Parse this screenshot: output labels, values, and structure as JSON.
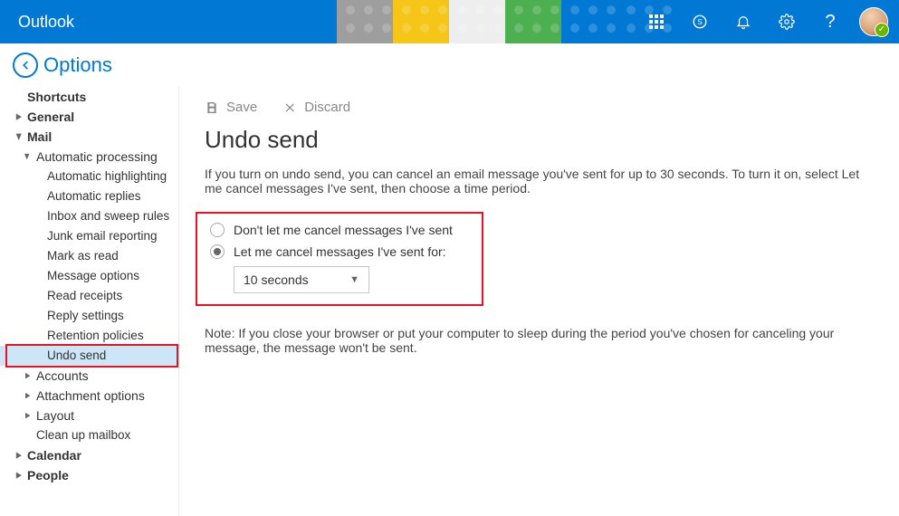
{
  "header": {
    "brand": "Outlook"
  },
  "options_label": "Options",
  "action": {
    "save": "Save",
    "discard": "Discard"
  },
  "page": {
    "title": "Undo send",
    "description": "If you turn on undo send, you can cancel an email message you've sent for up to 30 seconds. To turn it on, select Let me cancel messages I've sent, then choose a time period.",
    "radio_off": "Don't let me cancel messages I've sent",
    "radio_on": "Let me cancel messages I've sent for:",
    "select_value": "10 seconds",
    "note": "Note: If you close your browser or put your computer to sleep during the period you've chosen for canceling your message, the message won't be sent."
  },
  "sidebar": {
    "shortcuts": "Shortcuts",
    "general": "General",
    "mail": "Mail",
    "auto_processing": "Automatic processing",
    "auto_highlight": "Automatic highlighting",
    "auto_replies": "Automatic replies",
    "inbox_sweep": "Inbox and sweep rules",
    "junk": "Junk email reporting",
    "mark_read": "Mark as read",
    "msg_options": "Message options",
    "read_receipts": "Read receipts",
    "reply_settings": "Reply settings",
    "retention": "Retention policies",
    "undo_send": "Undo send",
    "accounts": "Accounts",
    "attachments": "Attachment options",
    "layout": "Layout",
    "cleanup": "Clean up mailbox",
    "calendar": "Calendar",
    "people": "People"
  }
}
